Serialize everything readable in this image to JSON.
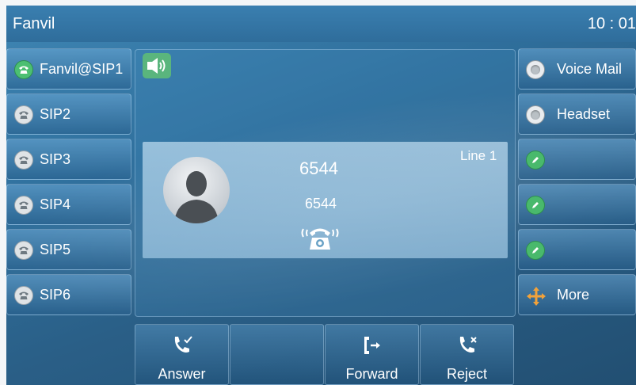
{
  "status": {
    "title": "Fanvil",
    "clock": "10 : 01"
  },
  "lines": [
    {
      "label": "Fanvil@SIP1",
      "state": "active",
      "icon": "phone-icon"
    },
    {
      "label": "SIP2",
      "state": "idle",
      "icon": "phone-icon"
    },
    {
      "label": "SIP3",
      "state": "idle",
      "icon": "phone-icon"
    },
    {
      "label": "SIP4",
      "state": "idle",
      "icon": "phone-icon"
    },
    {
      "label": "SIP5",
      "state": "idle",
      "icon": "phone-icon"
    },
    {
      "label": "SIP6",
      "state": "idle",
      "icon": "phone-icon"
    }
  ],
  "dss_keys": [
    {
      "label": "Voice Mail",
      "icon": "radio-icon"
    },
    {
      "label": "Headset",
      "icon": "radio-icon"
    },
    {
      "label": "",
      "icon": "edit-pencil-icon"
    },
    {
      "label": "",
      "icon": "edit-pencil-icon"
    },
    {
      "label": "",
      "icon": "edit-pencil-icon"
    },
    {
      "label": "More",
      "icon": "move-arrows-icon"
    }
  ],
  "call": {
    "speaker_icon": "speaker-icon",
    "name": "6544",
    "number": "6544",
    "line": "Line 1",
    "status_icon": "ringing-phone-icon"
  },
  "softkeys": [
    {
      "label": "Answer",
      "icon": "answer-call-icon"
    },
    {
      "label": "",
      "icon": ""
    },
    {
      "label": "Forward",
      "icon": "forward-call-icon"
    },
    {
      "label": "Reject",
      "icon": "reject-call-icon"
    }
  ],
  "colors": {
    "active_line": "#4cbf72",
    "speaker_badge": "#5ab57d",
    "more_arrows": "#f2a23a"
  }
}
